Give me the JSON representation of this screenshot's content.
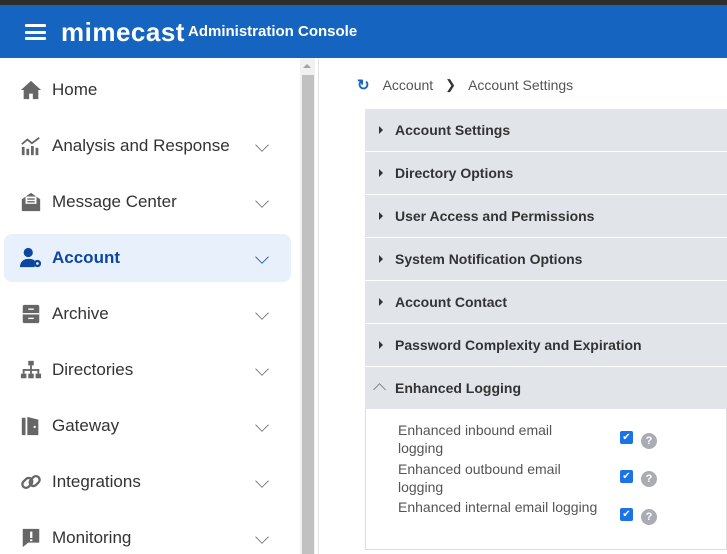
{
  "header": {
    "brand": "mimecast",
    "title": "Administration Console"
  },
  "sidebar": {
    "items": [
      {
        "label": "Home",
        "icon": "home-icon"
      },
      {
        "label": "Analysis and Response",
        "icon": "chart-icon"
      },
      {
        "label": "Message Center",
        "icon": "envelope-icon"
      },
      {
        "label": "Account",
        "icon": "user-gear-icon",
        "active": true
      },
      {
        "label": "Archive",
        "icon": "archive-icon"
      },
      {
        "label": "Directories",
        "icon": "hierarchy-icon"
      },
      {
        "label": "Gateway",
        "icon": "door-icon"
      },
      {
        "label": "Integrations",
        "icon": "link-icon"
      },
      {
        "label": "Monitoring",
        "icon": "alert-icon"
      }
    ]
  },
  "breadcrumb": {
    "items": [
      "Account",
      "Account Settings"
    ]
  },
  "accordion": {
    "sections": [
      "Account Settings",
      "Directory Options",
      "User Access and Permissions",
      "System Notification Options",
      "Account Contact",
      "Password Complexity and Expiration",
      "Enhanced Logging"
    ]
  },
  "enhanced_logging": {
    "options": [
      {
        "label": "Enhanced inbound email logging",
        "checked": true
      },
      {
        "label": "Enhanced outbound email logging",
        "checked": true
      },
      {
        "label": "Enhanced internal email logging",
        "checked": true
      }
    ]
  }
}
